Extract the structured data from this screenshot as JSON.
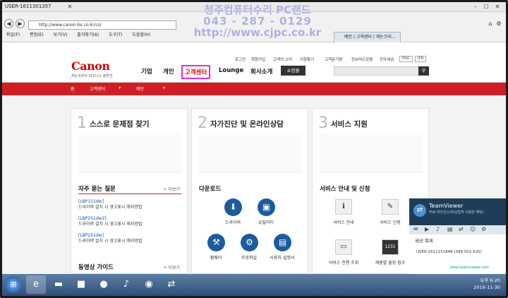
{
  "teamviewer_bar": {
    "title": "USER-1611301357"
  },
  "watermark": {
    "line1": "청주컴퓨터수리 PC랜드",
    "line2": "043 - 287 - 0129",
    "line3": "http://www.cjpc.co.kr"
  },
  "browser": {
    "address": "http://www.canon-bs.co.kr/cs/",
    "tabs": [
      "메인 | 고객센터 | 캐논코리...",
      ""
    ],
    "menu": [
      "파일(F)",
      "편집(E)",
      "보기(V)",
      "즐겨찾기(A)",
      "도구(T)",
      "도움말(H)"
    ]
  },
  "site": {
    "logo": "Canon",
    "logo_sub": "캐논코리아 비즈니스 솔루션",
    "nav": [
      "기업",
      "개인",
      "고객센터",
      "Lounge",
      "회사소개"
    ],
    "shop": "쇼핑몰",
    "util": [
      "로그인",
      "회원가입",
      "고객의 소리",
      "지점찾기",
      "고객문기편",
      "컨슈머스모음",
      "전자세금"
    ],
    "lang": [
      "ENG",
      "JPN"
    ],
    "crumb": [
      "홈",
      "고객센터",
      "메인"
    ]
  },
  "cards": [
    {
      "num": "1",
      "title": "스스로 문제점 찾기",
      "section": "자주 묻는 질문",
      "more": "+ 더보기",
      "faq": [
        {
          "model": "[LBP151dw]",
          "q": "드라이버 설치 시 경고표시 해지방법"
        },
        {
          "model": "[LBP251dw2]",
          "q": "드라이버 설치 시 경고표시 해지방법"
        },
        {
          "model": "[LBP251dw]",
          "q": "드라이버 설치 시 경고표시 해지방법"
        }
      ],
      "section2": "동영상 가이드",
      "more2": "+ 더보기"
    },
    {
      "num": "2",
      "title": "자가진단 및 온라인상담",
      "section": "다운로드",
      "items": [
        "드라이버",
        "유틸리티",
        "펌웨어",
        "프로파일",
        "사용자 설명서"
      ]
    },
    {
      "num": "3",
      "title": "서비스 지원",
      "section": "서비스 안내 및 신청",
      "items": [
        "서비스 안내",
        "서비스 신청",
        "서비스 진행 조회",
        "제품별 출장 접수"
      ]
    }
  ],
  "tv_panel": {
    "name": "TeamViewer",
    "sub": "무료 라이선스(비상업적 사용만 해당)",
    "session_title": "세션 목록",
    "session": "USER-1611151848 (399 502 620)",
    "link": "www.teamviewer.com"
  },
  "taskbar": {
    "time": "오후 6:20",
    "date": "2016-11-30"
  }
}
